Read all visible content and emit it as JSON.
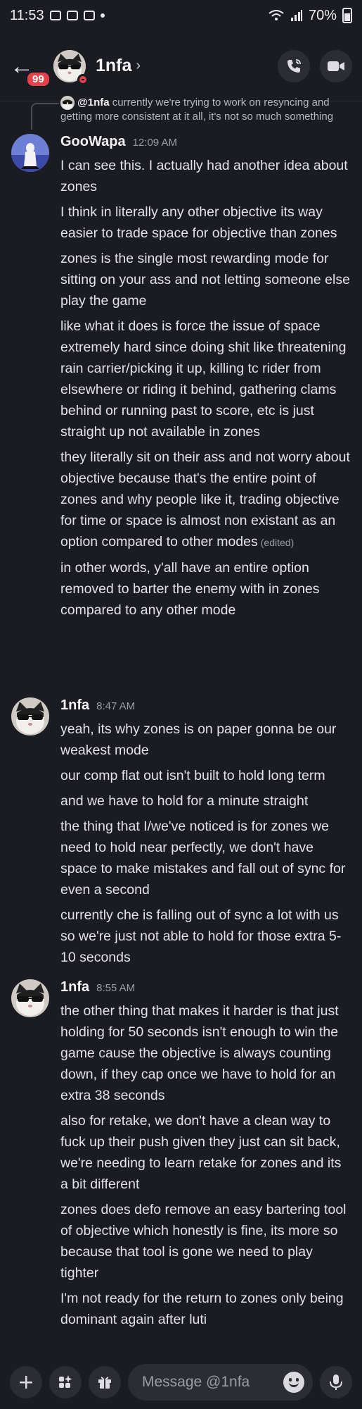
{
  "status_bar": {
    "time": "11:53",
    "battery": "70%"
  },
  "header": {
    "unread_count": "99",
    "title": "1nfa",
    "chevron": "›",
    "icons": {
      "back": "back-arrow-icon",
      "call": "phone-call-icon",
      "video": "video-camera-icon"
    }
  },
  "reply": {
    "mention": "@1nfa",
    "text": " currently we're trying to work on resyncing and getting more consistent at it all, it's not so much something"
  },
  "messages": [
    {
      "author": "GooWapa",
      "time": "12:09 AM",
      "lines": [
        "I can see this. I actually had another idea about zones",
        "I think in literally any other objective its way easier to trade space for objective than zones",
        "zones is the single most rewarding mode for sitting on your ass and not letting someone else play the game",
        "like what it does is force the issue of space extremely hard since doing shit like threatening rain carrier/picking it up, killing tc rider from elsewhere or riding it behind, gathering clams behind or running past to score, etc is just straight up not available in zones",
        "they literally sit on their ass and not worry about objective because that's the entire point of zones and why people like it, trading objective for time or space is almost non existant as an option compared to other modes",
        "in other words, y'all have an entire option removed to barter the enemy with in zones compared to any other mode"
      ],
      "edited_label": "(edited)"
    },
    {
      "author": "1nfa",
      "time": "8:47 AM",
      "lines": [
        "yeah, its why zones is on paper gonna be our weakest mode",
        "our comp flat out isn't built to hold long term",
        "and we have to hold for a minute straight",
        "the thing that I/we've noticed is for zones we need to hold near perfectly, we don't have space to make mistakes and fall out of sync for even a second",
        "currently che is falling out of sync a lot with us so we're just not able to hold for those extra 5-10 seconds"
      ]
    },
    {
      "author": "1nfa",
      "time": "8:55 AM",
      "lines": [
        "the other thing that makes it harder is that just holding for 50 seconds isn't enough to win the game cause the objective is always counting down, if they cap once we have to hold for an extra 38 seconds",
        "also for retake, we don't have a clean way to fuck up their push given they just can sit back, we're needing to learn retake for zones and its a bit different",
        "zones does defo remove an easy bartering tool of objective which honestly is fine, its more so because that tool is gone we need to play tighter",
        "I'm not ready for the return to zones only being dominant again after luti"
      ]
    }
  ],
  "input": {
    "placeholder": "Message @1nfa"
  },
  "colors": {
    "background": "#1b1b22",
    "badge": "#e4424a",
    "button": "#2b2c34"
  }
}
